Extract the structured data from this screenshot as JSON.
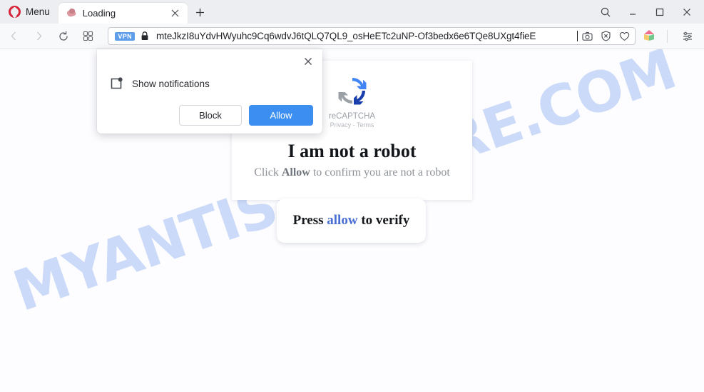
{
  "browser": {
    "menu_label": "Menu",
    "tab": {
      "title": "Loading",
      "close_label": "×"
    },
    "new_tab_label": "+",
    "window_controls": {
      "search": "search-icon",
      "minimize": "minimize-icon",
      "maximize": "maximize-icon",
      "close": "close-icon"
    },
    "nav": {
      "back": "back-icon",
      "forward": "forward-icon",
      "reload": "reload-icon",
      "speeddial": "grid-icon"
    },
    "omnibox": {
      "vpn_badge": "VPN",
      "lock": "padlock-icon",
      "url": "mteJkzI8uYdvHWyuhc9Cq6wdvJ6tQLQ7QL9_osHeETc2uNP-Of3bedx6e6TQe8UXgt4fieE",
      "snapshot": "camera-icon",
      "adblock": "shield-x-icon",
      "favorite": "heart-icon"
    },
    "toolbar_right": {
      "workspaces": "cube-icon",
      "easy_setup": "sliders-icon"
    }
  },
  "permission_popup": {
    "close_label": "×",
    "icon": "notification-icon",
    "message": "Show notifications",
    "block_label": "Block",
    "allow_label": "Allow"
  },
  "page": {
    "watermark": "MYANTISPYWARE.COM",
    "recaptcha": {
      "brand": "reCAPTCHA",
      "privacy": "Privacy",
      "separator": "-",
      "terms": "Terms"
    },
    "headline": "I am not a robot",
    "sub_prefix": "Click ",
    "sub_bold": "Allow",
    "sub_suffix": " to confirm you are not a robot",
    "press_prefix": "Press ",
    "press_highlight": "allow",
    "press_suffix": " to verify"
  },
  "colors": {
    "accent_blue": "#3c8ef0",
    "opera_red": "#d6243a",
    "watermark_blue": "#c3d4f7",
    "link_blue": "#4a6fd4",
    "vpn_blue": "#5f9eea"
  }
}
